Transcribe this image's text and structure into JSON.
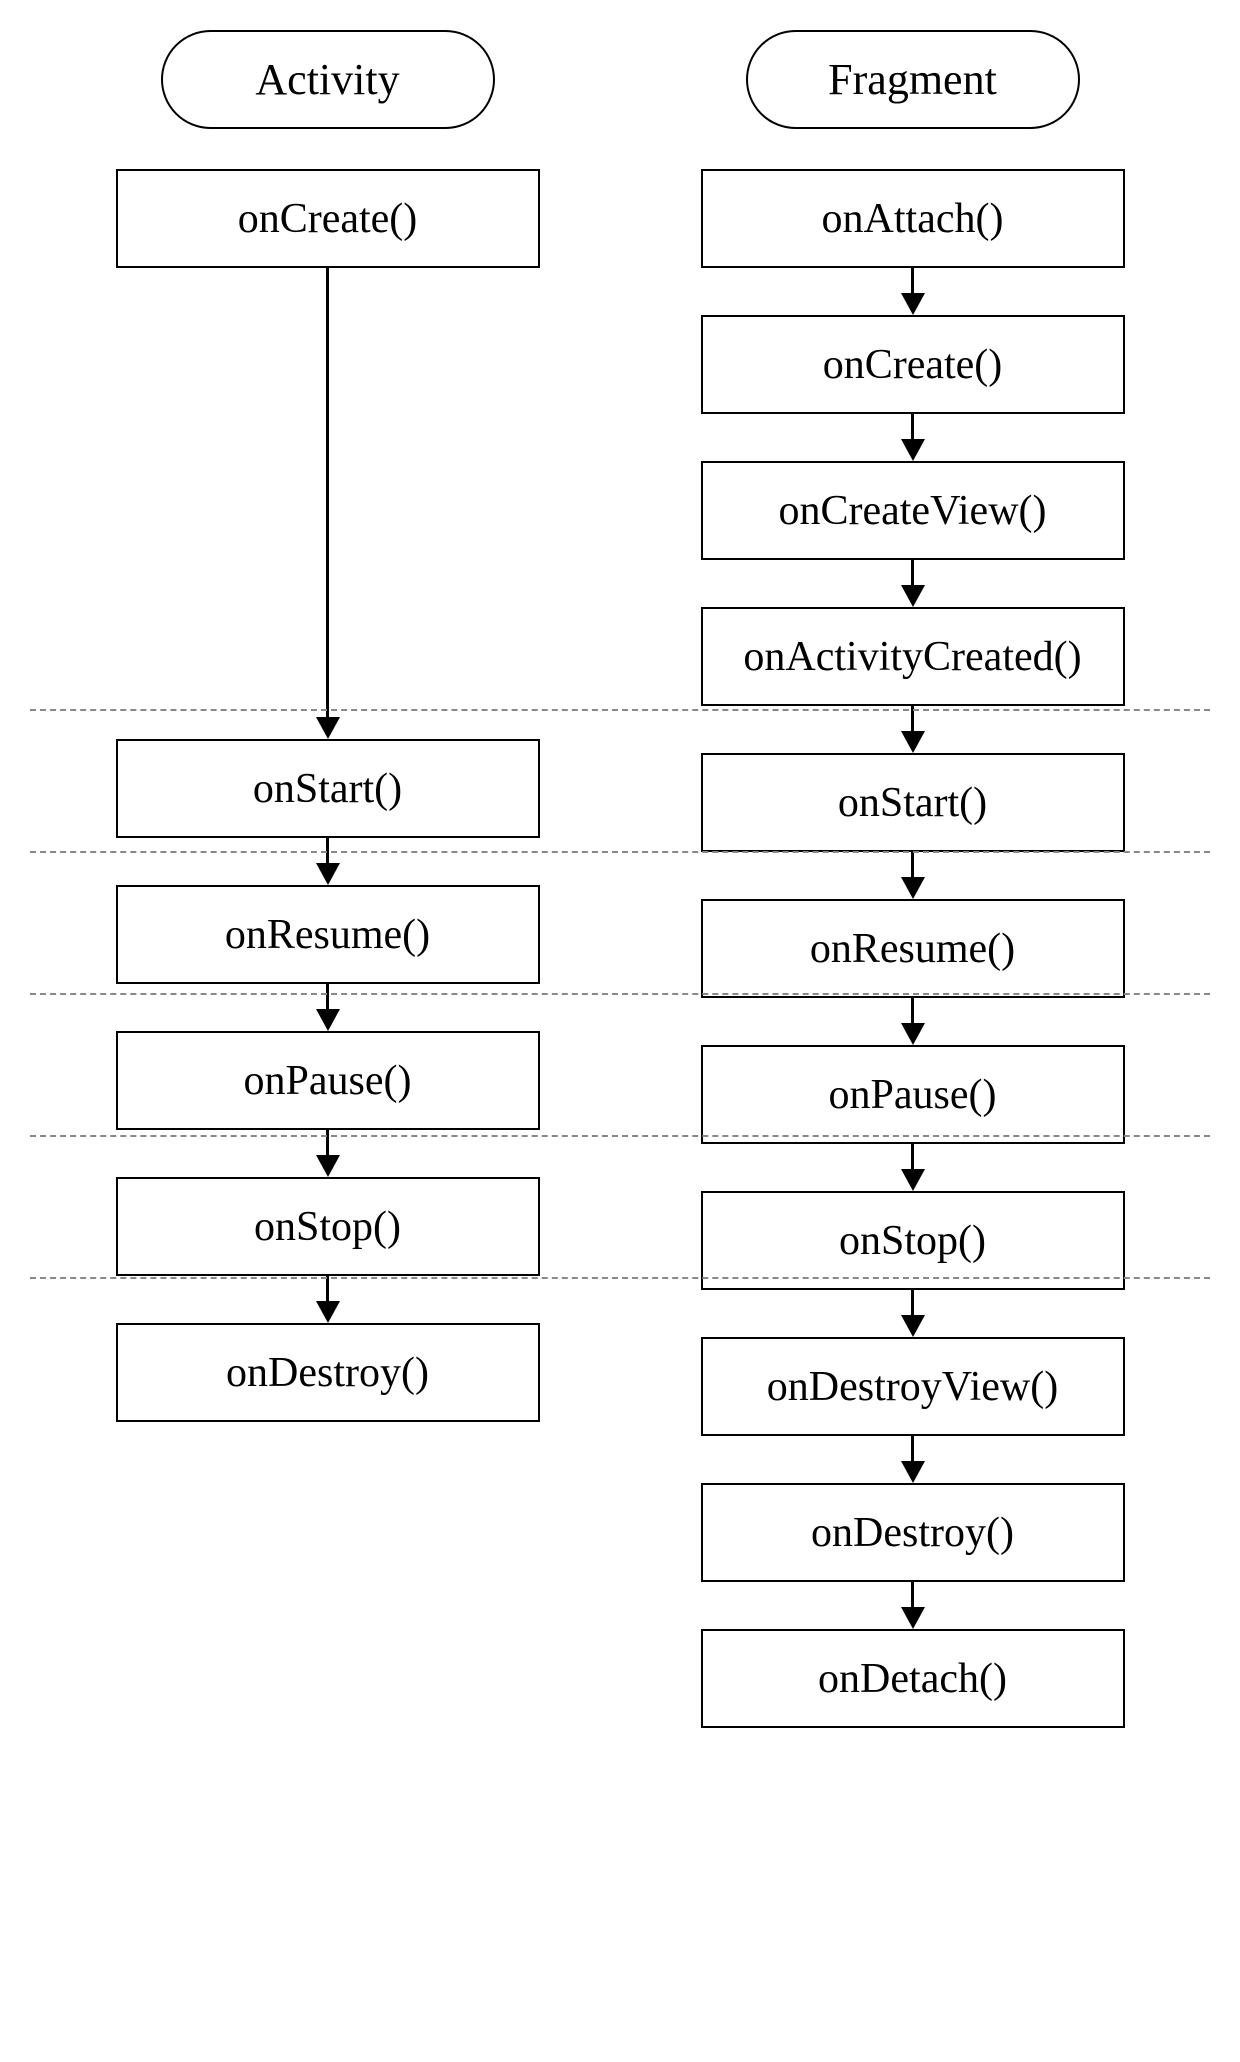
{
  "headers": {
    "activity": "Activity",
    "fragment": "Fragment"
  },
  "activity": {
    "onCreate": "onCreate()",
    "onStart": "onStart()",
    "onResume": "onResume()",
    "onPause": "onPause()",
    "onStop": "onStop()",
    "onDestroy": "onDestroy()"
  },
  "fragment": {
    "onAttach": "onAttach()",
    "onCreate": "onCreate()",
    "onCreateView": "onCreateView()",
    "onActivityCreated": "onActivityCreated()",
    "onStart": "onStart()",
    "onResume": "onResume()",
    "onPause": "onPause()",
    "onStop": "onStop()",
    "onDestroyView": "onDestroyView()",
    "onDestroy": "onDestroy()",
    "onDetach": "onDetach()"
  }
}
